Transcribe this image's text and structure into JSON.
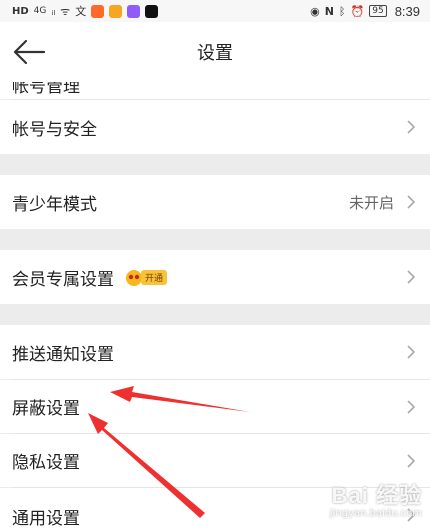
{
  "status_bar": {
    "left_icons": [
      "HD",
      "4G",
      "ᵢₗ",
      "ᯤ",
      "文"
    ],
    "battery": "95",
    "time": "8:39"
  },
  "header": {
    "title": "设置"
  },
  "rows": {
    "account_manage": "帐号管理",
    "account_security": "帐号与安全",
    "youth_mode": "青少年模式",
    "youth_mode_value": "未开启",
    "vip_settings": "会员专属设置",
    "vip_badge": "开通",
    "push_settings": "推送通知设置",
    "block_settings": "屏蔽设置",
    "privacy_settings": "隐私设置",
    "general_settings": "通用设置"
  },
  "watermark": {
    "logo": "Bai 经验",
    "url": "jingyan.baidu.com"
  },
  "colors": {
    "arrow": "#ee3030",
    "page_bg": "#ececec",
    "badge": "#f7c33b"
  }
}
